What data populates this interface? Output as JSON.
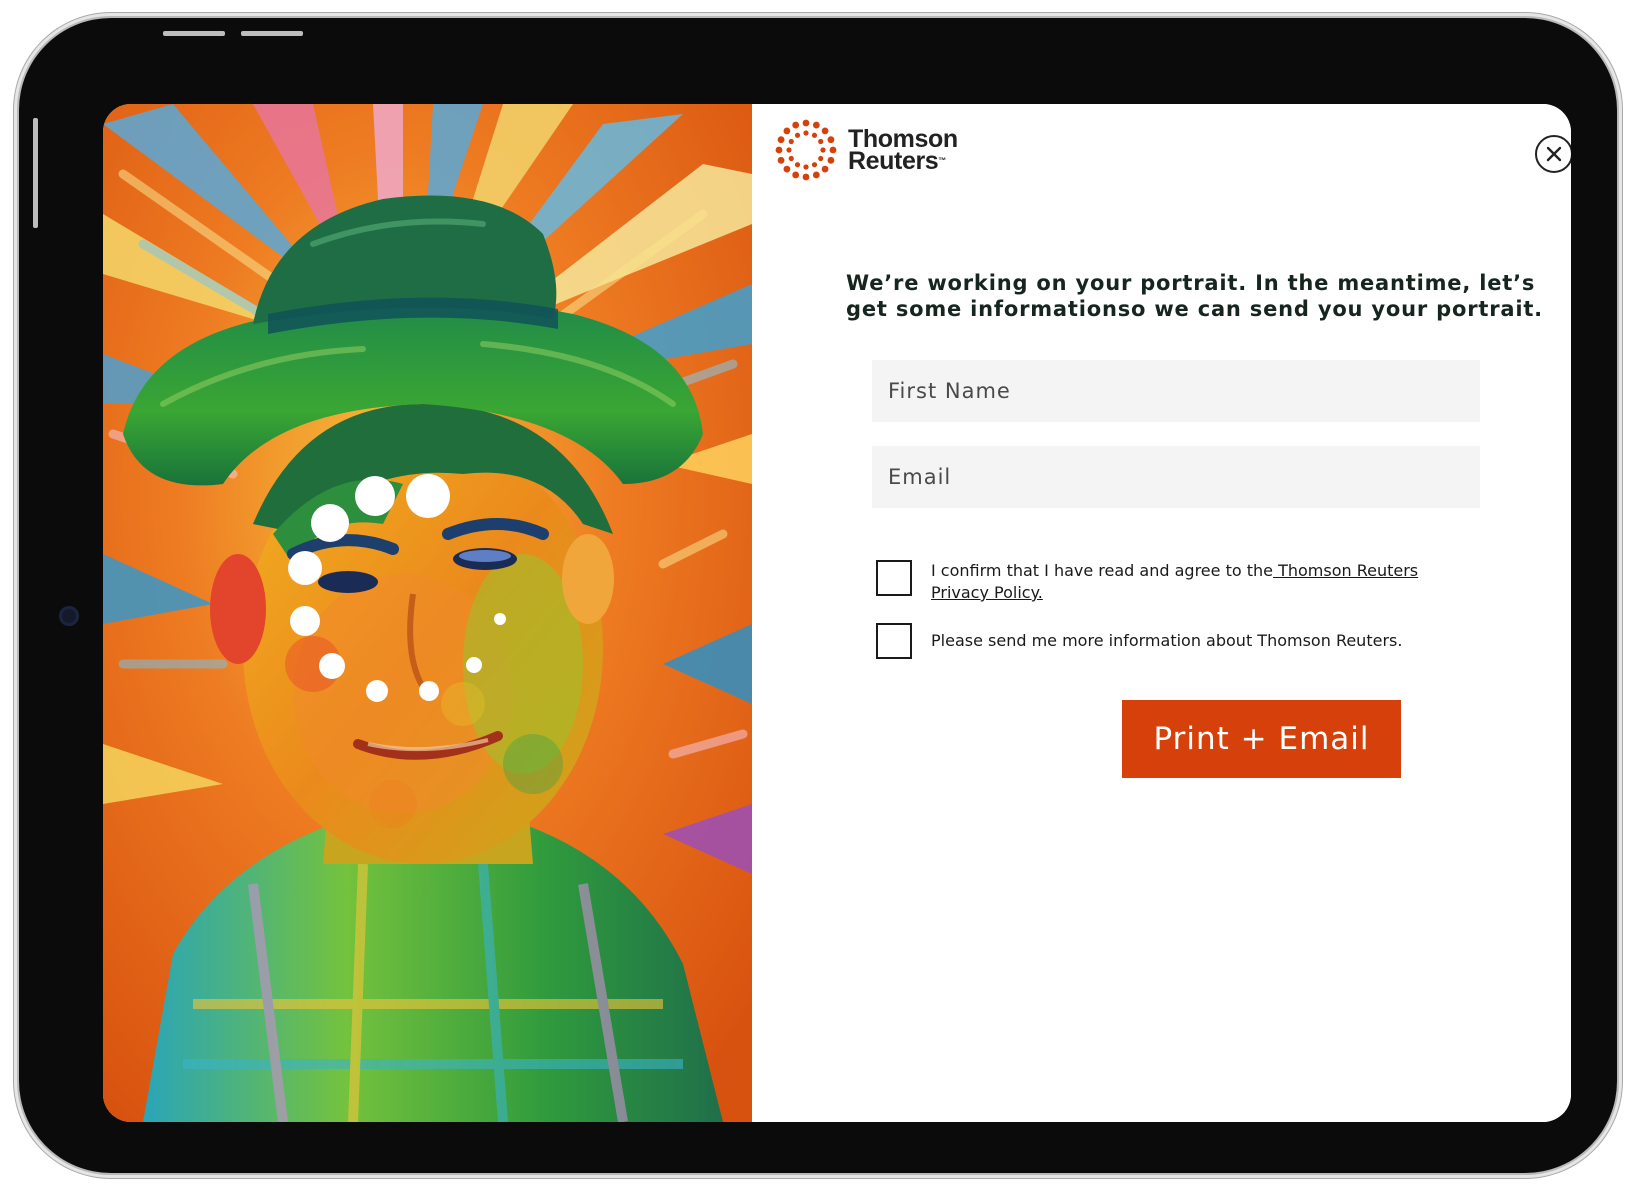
{
  "brand": {
    "name_line1": "Thomson",
    "name_line2": "Reuters",
    "trademark": "™",
    "logo_icon": "dotted-circle-logo",
    "accent_color": "#d6400a"
  },
  "close_icon": "close-icon",
  "headline": "We’re working on your portrait. In the meantime, let’s get some informationso we can send you your portrait.",
  "form": {
    "first_name_placeholder": "First Name",
    "first_name_value": "",
    "email_placeholder": "Email",
    "email_value": "",
    "consent": {
      "checked": false,
      "text": "I confirm that I have read and agree to the",
      "link_text": " Thomson Reuters Privacy Policy."
    },
    "marketing": {
      "checked": false,
      "text": "Please send me more information about Thomson Reuters."
    },
    "submit_label": "Print + Email"
  },
  "portrait": {
    "subject": "stylized-painted-portrait",
    "loading_indicator": "spinner-dots-icon"
  }
}
